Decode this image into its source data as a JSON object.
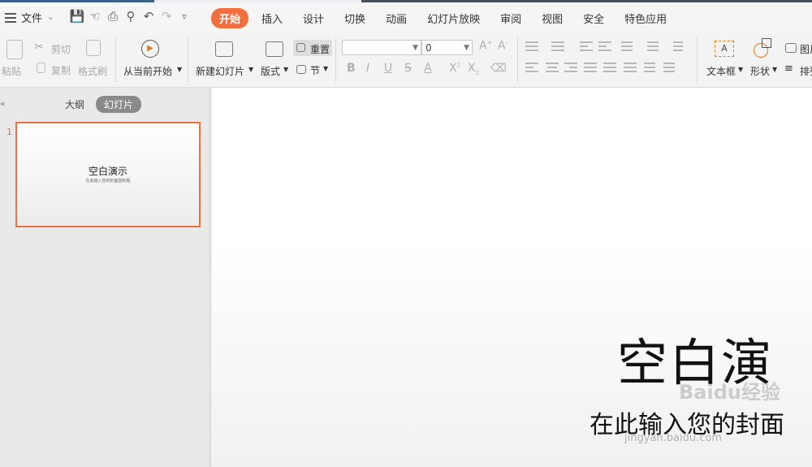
{
  "menu": {
    "file_label": "文件",
    "tabs": [
      "开始",
      "插入",
      "设计",
      "切换",
      "动画",
      "幻灯片放映",
      "审阅",
      "视图",
      "安全",
      "特色应用"
    ]
  },
  "ribbon": {
    "paste": "粘贴",
    "cut": "剪切",
    "copy": "复制",
    "format_painter": "格式刷",
    "from_current": "从当前开始",
    "new_slide": "新建幻灯片",
    "layout": "版式",
    "reset": "重置",
    "section": "节",
    "font_size_value": "0",
    "text_box": "文本框",
    "shape": "形状",
    "picture": "图片",
    "arrange": "排列"
  },
  "panel": {
    "tab_outline": "大纲",
    "tab_slides": "幻灯片",
    "slide_number": "1",
    "thumb_title": "空白演示",
    "thumb_subtitle": "在此输入您的封面副标题"
  },
  "slide": {
    "title": "空白演",
    "subtitle": "在此输入您的封面"
  },
  "watermark": {
    "main": "Baidu经验",
    "url": "jingyan.baidu.com"
  },
  "colors": {
    "accent": "#f36f3d"
  }
}
